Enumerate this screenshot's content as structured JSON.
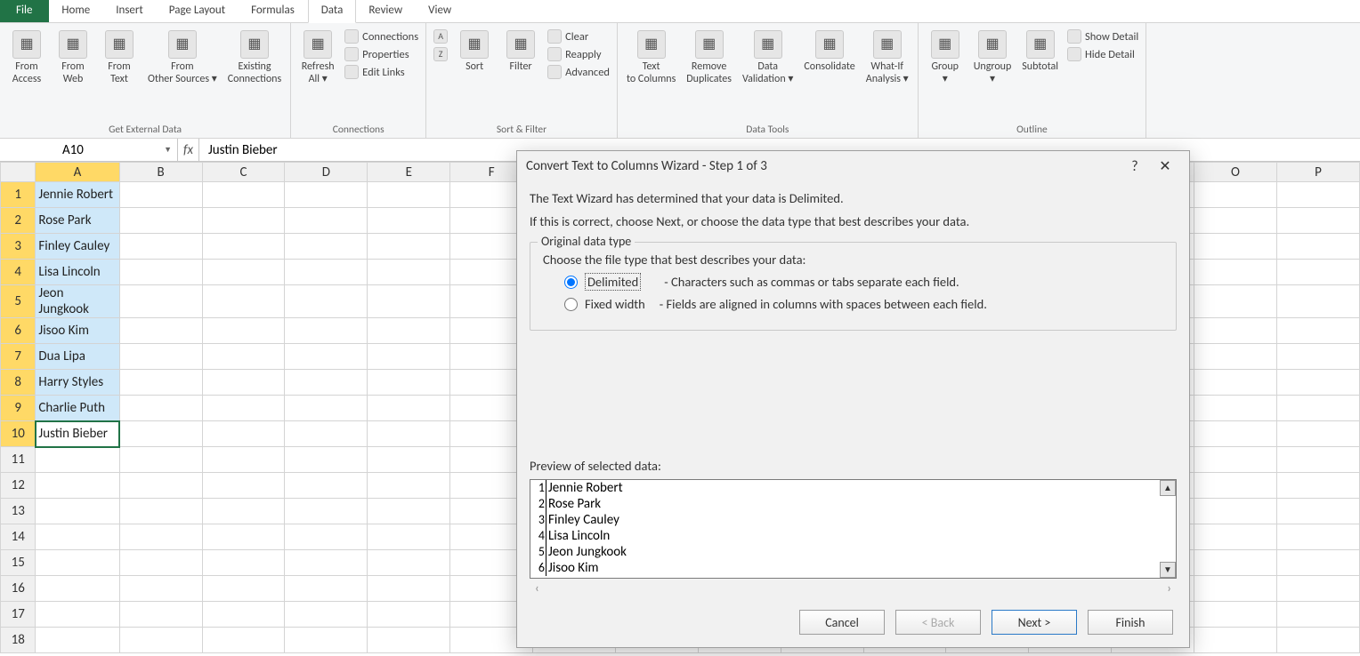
{
  "tabs": [
    "File",
    "Home",
    "Insert",
    "Page Layout",
    "Formulas",
    "Data",
    "Review",
    "View"
  ],
  "active_tab": "Data",
  "ribbon": {
    "groups": [
      {
        "label": "Get External Data",
        "items": [
          "From Access",
          "From Web",
          "From Text",
          "From Other Sources ▾",
          "Existing Connections"
        ]
      },
      {
        "label": "Connections",
        "big": "Refresh All ▾",
        "items": [
          "Connections",
          "Properties",
          "Edit Links"
        ]
      },
      {
        "label": "Sort & Filter",
        "big": [
          "Sort",
          "Filter"
        ],
        "items": [
          "Clear",
          "Reapply",
          "Advanced"
        ]
      },
      {
        "label": "Data Tools",
        "items": [
          "Text to Columns",
          "Remove Duplicates",
          "Data Validation ▾",
          "Consolidate",
          "What-If Analysis ▾"
        ]
      },
      {
        "label": "Outline",
        "items": [
          "Group ▾",
          "Ungroup ▾",
          "Subtotal"
        ],
        "side": [
          "Show Detail",
          "Hide Detail"
        ]
      }
    ]
  },
  "namebox": "A10",
  "formula": "Justin Bieber",
  "columns": [
    "A",
    "B",
    "C",
    "D",
    "E",
    "F",
    "N",
    "O",
    "P"
  ],
  "rows": [
    "Jennie Robert",
    "Rose Park",
    "Finley Cauley",
    "Lisa Lincoln",
    "Jeon Jungkook",
    "Jisoo Kim",
    "Dua Lipa",
    "Harry Styles",
    "Charlie Puth",
    "Justin Bieber",
    "",
    "",
    "",
    "",
    "",
    "",
    "",
    ""
  ],
  "active_row": 10,
  "dialog": {
    "title": "Convert Text to Columns Wizard - Step 1 of 3",
    "line1": "The Text Wizard has determined that your data is Delimited.",
    "line2": "If this is correct, choose Next, or choose the data type that best describes your data.",
    "group_label": "Original data type",
    "choose": "Choose the file type that best describes your data:",
    "opt_delim": "Delimited",
    "opt_delim_desc": "- Characters such as commas or tabs separate each field.",
    "opt_fixed": "Fixed width",
    "opt_fixed_desc": "- Fields are aligned in columns with spaces between each field.",
    "preview_label": "Preview of selected data:",
    "preview": [
      "Jennie Robert",
      "Rose Park",
      "Finley Cauley",
      "Lisa Lincoln",
      "Jeon Jungkook",
      "Jisoo Kim"
    ],
    "buttons": {
      "cancel": "Cancel",
      "back": "< Back",
      "next": "Next >",
      "finish": "Finish"
    }
  }
}
